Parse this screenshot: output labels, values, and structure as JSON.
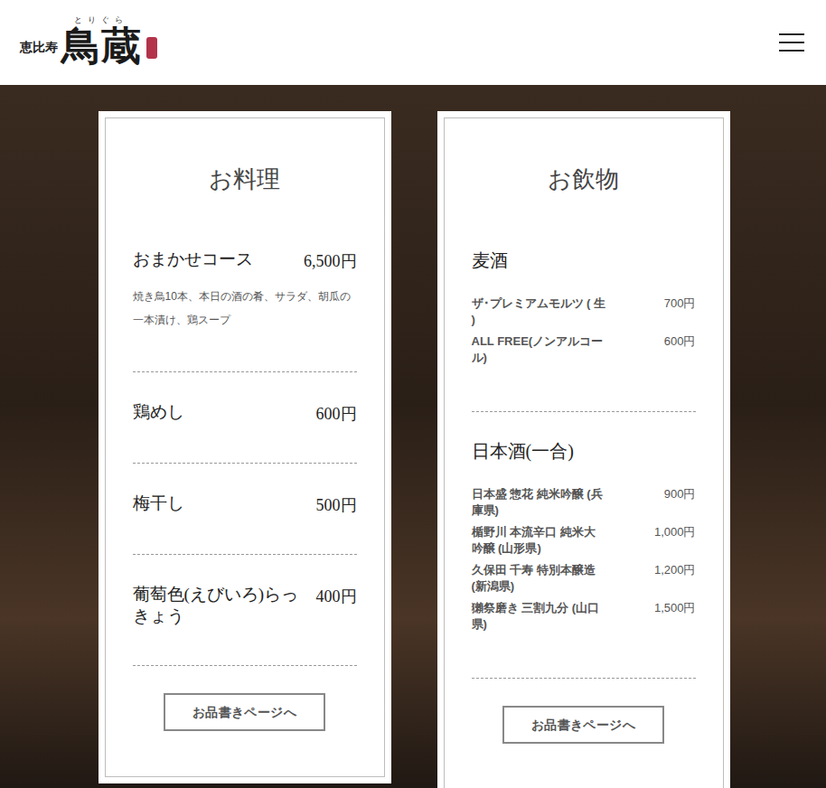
{
  "header": {
    "logo": {
      "area": "恵比寿",
      "name": "鳥蔵",
      "ruby": "とりぐら"
    }
  },
  "cards": {
    "food": {
      "title": "お料理",
      "items": [
        {
          "name": "おまかせコース",
          "price": "6,500円",
          "description": "焼き鳥10本、本日の酒の肴、サラダ、胡瓜の一本漬け、鶏スープ"
        },
        {
          "name": "鶏めし",
          "price": "600円",
          "description": ""
        },
        {
          "name": "梅干し",
          "price": "500円",
          "description": ""
        },
        {
          "name": "葡萄色(えびいろ)らっきょう",
          "price": "400円",
          "description": ""
        }
      ],
      "button": "お品書きページへ"
    },
    "drinks": {
      "title": "お飲物",
      "sections": [
        {
          "heading": "麦酒",
          "items": [
            {
              "name": "ザ･プレミアムモルツ ( 生 )",
              "price": "700円"
            },
            {
              "name": "ALL FREE(ノンアルコール)",
              "price": "600円"
            }
          ]
        },
        {
          "heading": "日本酒(一合)",
          "items": [
            {
              "name": "日本盛 惣花 純米吟醸 (兵庫県)",
              "price": "900円"
            },
            {
              "name": "楯野川 本流辛口 純米大吟醸 (山形県)",
              "price": "1,000円"
            },
            {
              "name": "久保田 千寿 特別本醸造 (新潟県)",
              "price": "1,200円"
            },
            {
              "name": "獺祭磨き 三割九分 (山口県)",
              "price": "1,500円"
            }
          ]
        }
      ],
      "button": "お品書きページへ"
    }
  }
}
